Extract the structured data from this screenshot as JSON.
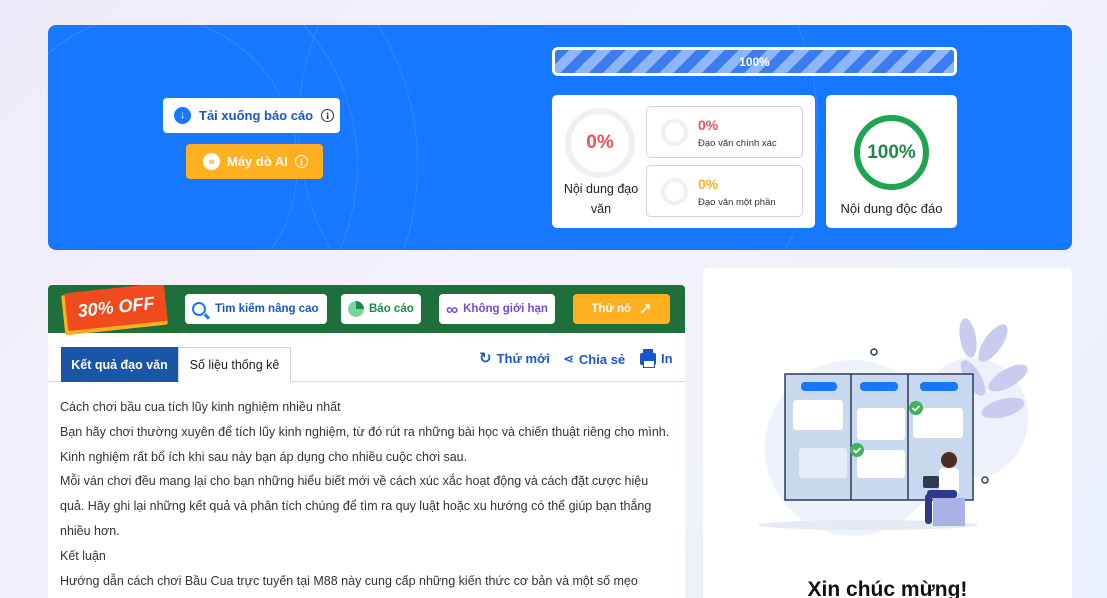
{
  "hero": {
    "download_label": "Tải xuống báo cáo",
    "ai_detector_label": "Máy dò AI",
    "progress": 100,
    "progress_label": "100%",
    "plagiarism": {
      "value": "0%",
      "label": "Nội dung đạo văn"
    },
    "exact": {
      "value": "0%",
      "label": "Đạo văn chính xác",
      "color": "#f0505a"
    },
    "partial": {
      "value": "0%",
      "label": "Đạo văn một phần",
      "color": "#ffb020"
    },
    "unique": {
      "value": "100%",
      "label": "Nội dung độc đáo",
      "color": "#1fa451"
    }
  },
  "promo": {
    "badge": "30% OFF",
    "chips": [
      "Tìm kiếm nâng cao",
      "Báo cáo",
      "Không giới hạn"
    ],
    "try_label": "Thử nó"
  },
  "tabs": {
    "active": "Kết quả đạo văn",
    "inactive": "Số liệu thống kê",
    "actions": {
      "retry": "Thử mới",
      "share": "Chia sẻ",
      "print": "In"
    }
  },
  "content": {
    "paragraphs": [
      "Cách chơi bầu cua tích lũy kinh nghiệm nhiều nhất",
      "Bạn hãy chơi thường xuyên để tích lũy kinh nghiệm, từ đó rút ra những bài học và chiến thuật riêng cho mình. Kinh nghiệm rất bổ ích khi sau này bạn áp dụng cho nhiều cuộc chơi sau.",
      "Mỗi ván chơi đều mang lại cho bạn những hiểu biết mới về cách xúc xắc hoạt động và cách đặt cược hiệu quả. Hãy ghi lại những kết quả và phân tích chúng để tìm ra quy luật hoặc xu hướng có thể giúp bạn thắng nhiều hơn.",
      "Kết luận",
      "Hướng dẫn cách chơi Bầu Cua trực tuyến tại M88 này cung cấp những kiến thức cơ bản và một số mẹo"
    ]
  },
  "sidebar": {
    "congrats": "Xin chúc mừng!"
  }
}
